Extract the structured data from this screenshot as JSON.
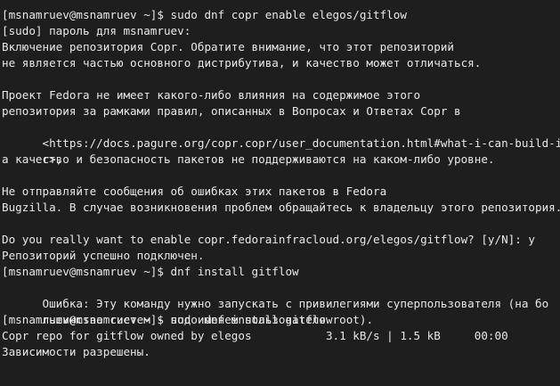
{
  "terminal": {
    "lines": [
      "[msnamruev@msnamruev ~]$ sudo dnf copr enable elegos/gitflow",
      "[sudo] пароль для msnamruev:",
      "Включение репозитория Copr. Обратите внимание, что этот репозиторий",
      "не является частью основного дистрибутива, и качество может отличаться.",
      "",
      "Проект Fedora не имеет какого-либо влияния на содержимое этого",
      "репозитория за рамками правил, описанных в Вопросах и Ответах Copr в",
      "<https://docs.pagure.org/copr.copr/user_documentation.html#what-i-can-build-in-copr>,",
      "а качество и безопасность пакетов не поддерживаются на каком-либо уровне.",
      "",
      "Не отправляйте сообщения об ошибках этих пакетов в Fedora",
      "Bugzilla. В случае возникновения проблем обращайтесь к владельцу этого репозитория.",
      "",
      "Do you really want to enable copr.fedorainfracloud.org/elegos/gitflow? [y/N]: y",
      "Репозиторий успешно подключен.",
      "[msnamruev@msnamruev ~]$ dnf install gitflow",
      "Ошибка: Эту команду нужно запускать с привилегиями суперпользователя (на большинстве систем - под именем пользователя root).",
      "[msnamruev@msnamruev ~]$ sudo dnf install gitflow",
      "Copr repo for gitflow owned by elegos           3.1 kB/s | 1.5 kB     00:00",
      "Зависимости разрешены."
    ]
  }
}
